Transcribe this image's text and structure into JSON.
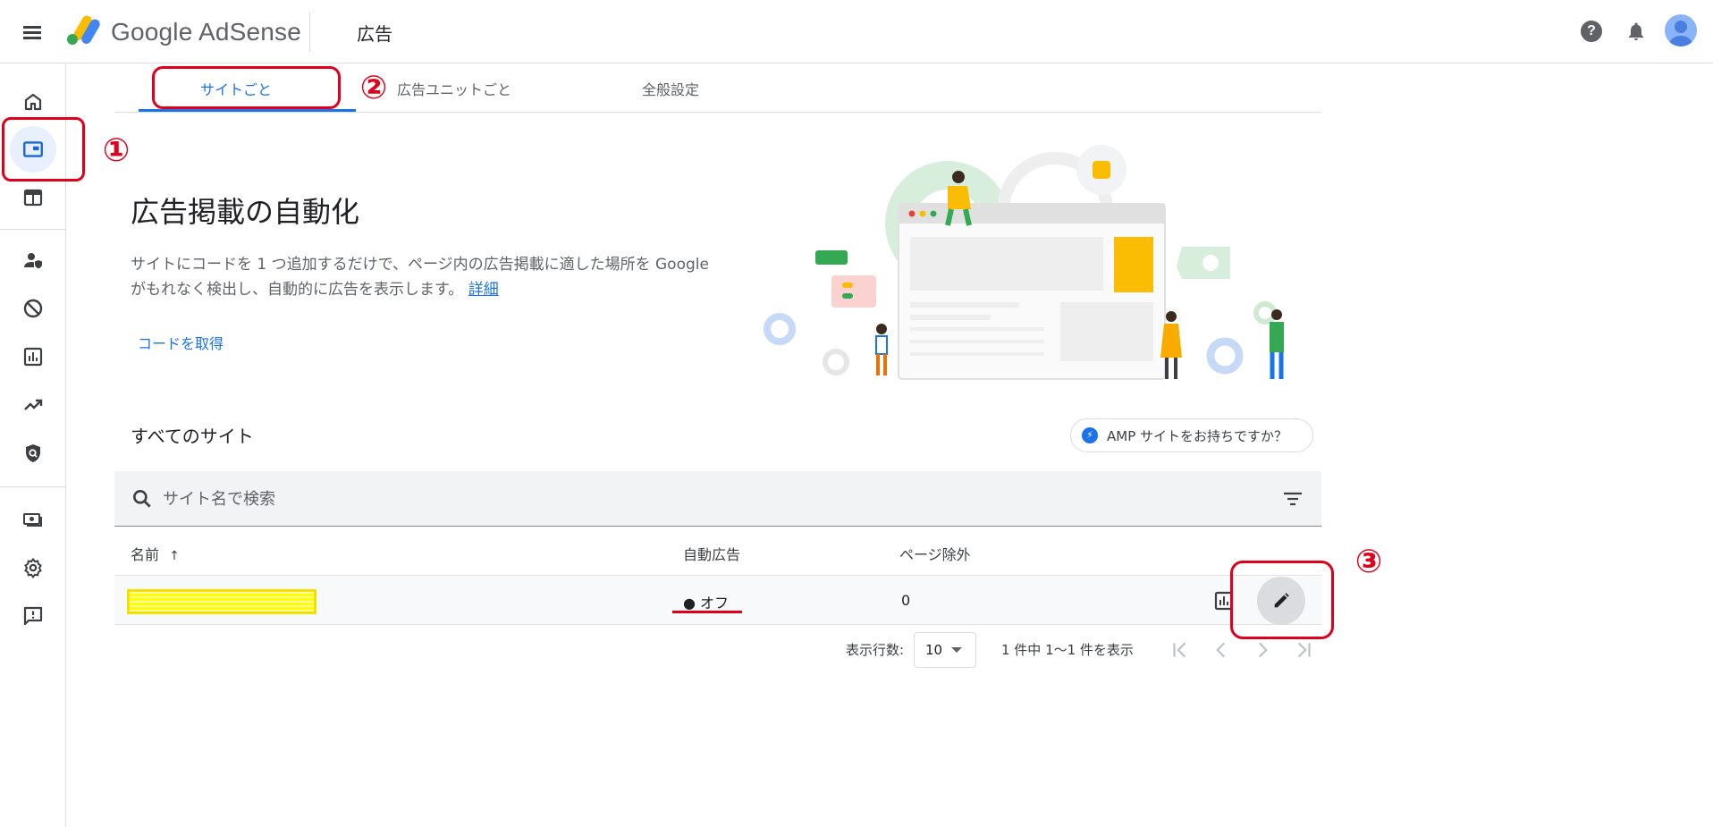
{
  "header": {
    "brand_google": "Google",
    "brand_product": "AdSense",
    "page_title": "広告",
    "help_icon": "?"
  },
  "sidebar": {
    "items": [
      {
        "icon": "home-icon"
      },
      {
        "icon": "ads-icon",
        "active": true
      },
      {
        "icon": "layout-icon"
      },
      {
        "icon": "privacy-messaging-icon"
      },
      {
        "icon": "block-icon"
      },
      {
        "icon": "reports-icon"
      },
      {
        "icon": "optimization-icon"
      },
      {
        "icon": "policy-center-icon"
      },
      {
        "icon": "payments-icon"
      },
      {
        "icon": "settings-icon"
      },
      {
        "icon": "feedback-icon"
      }
    ]
  },
  "tabs": [
    {
      "label": "サイトごと",
      "active": true
    },
    {
      "label": "広告ユニットごと"
    },
    {
      "label": "全般設定"
    }
  ],
  "hero": {
    "title": "広告掲載の自動化",
    "description_line1": "サイトにコードを 1 つ追加するだけで、ページ内の広告掲載に適した場所を Google",
    "description_line2": "がもれなく検出し、自動的に広告を表示します。",
    "learn_more": "詳細",
    "get_code": "コードを取得"
  },
  "sites": {
    "title": "すべてのサイト",
    "amp_chip": "AMP サイトをお持ちですか？",
    "search_placeholder": "サイト名で検索",
    "columns": {
      "name": "名前",
      "sort_arrow": "↑",
      "auto_ads": "自動広告",
      "page_exclusion": "ページ除外"
    },
    "rows": [
      {
        "auto_ads": "● オフ",
        "page_exclusion": "0"
      }
    ],
    "pagination": {
      "rows_label": "表示行数:",
      "rows_value": "10",
      "range_label": "1 件中 1〜1 件を表示"
    }
  },
  "annotations": {
    "one": "①",
    "two": "②",
    "three": "③",
    "color": "#e0001b"
  },
  "colors": {
    "accent": "#1a73e8",
    "highlight": "#ffff00"
  }
}
